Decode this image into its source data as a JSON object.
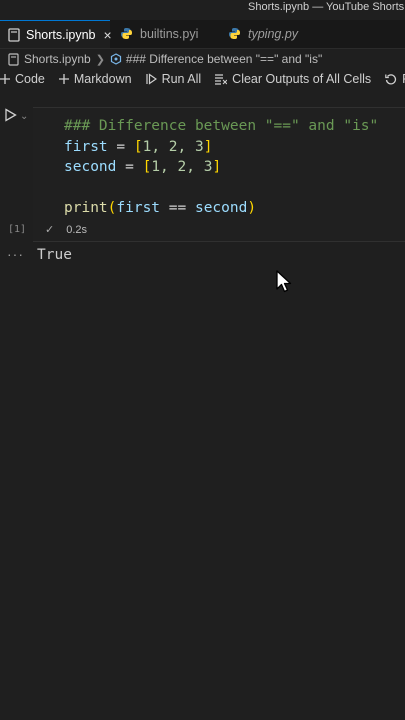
{
  "window": {
    "title": "Shorts.ipynb — YouTube Shorts S"
  },
  "tabs": [
    {
      "label": "Shorts.ipynb",
      "active": true,
      "close": "×"
    },
    {
      "label": "builtins.pyi",
      "active": false
    },
    {
      "label": "typing.py",
      "active": false
    }
  ],
  "breadcrumb": {
    "file": "Shorts.ipynb",
    "section": "### Difference between \"==\" and \"is\""
  },
  "toolbar": {
    "code_label": "Code",
    "markdown_label": "Markdown",
    "run_all_label": "Run All",
    "clear_outputs_label": "Clear Outputs of All Cells",
    "restart_label": "Re"
  },
  "cell": {
    "lines": {
      "comment": "### Difference between \"==\" and \"is\"",
      "l2_var": "first",
      "l2_eq": " = ",
      "l2_open": "[",
      "l2_body": "1, 2, 3",
      "l2_close": "]",
      "l3_var": "second",
      "l3_eq": " = ",
      "l3_open": "[",
      "l3_body": "1, 2, 3",
      "l3_close": "]",
      "l5_fn": "print",
      "l5_open": "(",
      "l5_a": "first",
      "l5_op": " == ",
      "l5_b": "second",
      "l5_close": ")"
    },
    "execution_count": "[1]",
    "duration": "0.2s",
    "output_ellipsis": "···",
    "output": "True"
  },
  "colors": {
    "accent": "#0078d4",
    "background": "#1f1f1f",
    "comment": "#6a9955",
    "variable": "#9cdcfe"
  }
}
